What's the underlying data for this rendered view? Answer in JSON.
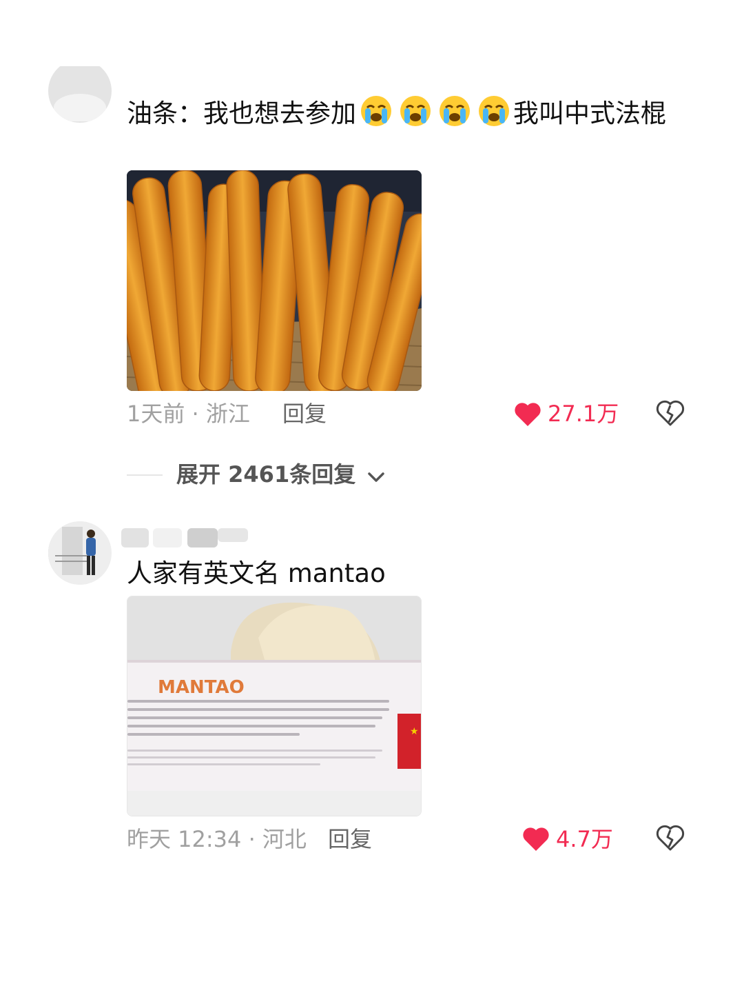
{
  "comments": [
    {
      "text_prefix": "油条：我也想去参加",
      "emoji": [
        "loudly-crying-face",
        "loudly-crying-face",
        "loudly-crying-face",
        "loudly-crying-face"
      ],
      "text_suffix": "我叫中式法棍",
      "meta": "1天前 · 浙江",
      "reply_label": "回复",
      "likes": "27.1万",
      "image_icon": "youtiao-photo"
    },
    {
      "text": "人家有英文名 mantao",
      "image_label": "MANTAO",
      "meta": "昨天 12:34 · 河北",
      "reply_label": "回复",
      "likes": "4.7万",
      "image_icon": "mantao-photo"
    }
  ],
  "expand": {
    "label": "展开 2461条回复"
  },
  "colors": {
    "like_red": "#f22b52",
    "meta_gray": "#a0a0a0",
    "text_dark": "#111111"
  }
}
